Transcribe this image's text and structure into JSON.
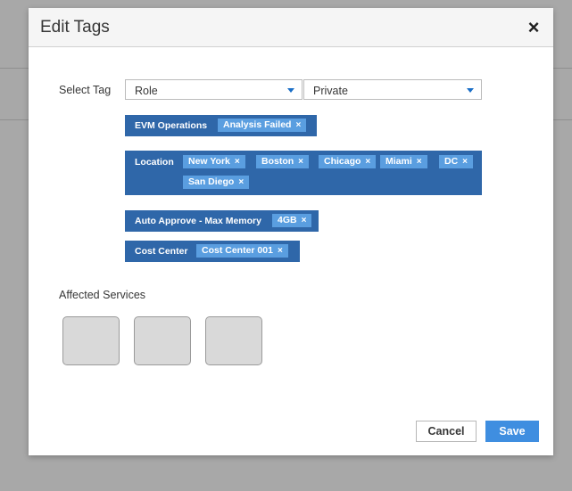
{
  "modal": {
    "title": "Edit Tags",
    "close_glyph": "×"
  },
  "select_tag": {
    "label": "Select Tag",
    "category_value": "Role",
    "value_value": "Private"
  },
  "tag_groups": [
    {
      "category": "EVM Operations",
      "values": [
        "Analysis Failed"
      ]
    },
    {
      "category": "Location",
      "values": [
        "New York",
        "Boston",
        "Chicago",
        "Miami",
        "DC",
        "San Diego"
      ]
    },
    {
      "category": "Auto Approve - Max Memory",
      "values": [
        "4GB"
      ]
    },
    {
      "category": "Cost Center",
      "values": [
        "Cost Center 001"
      ]
    }
  ],
  "remove_glyph": "×",
  "affected_services": {
    "label": "Affected Services",
    "count": 3
  },
  "footer": {
    "cancel_label": "Cancel",
    "save_label": "Save"
  },
  "colors": {
    "tag_group_bg": "#2f67a9",
    "chip_bg": "#5a9ee0",
    "primary_button": "#3f8ee0",
    "caret": "#1a6ec7"
  }
}
